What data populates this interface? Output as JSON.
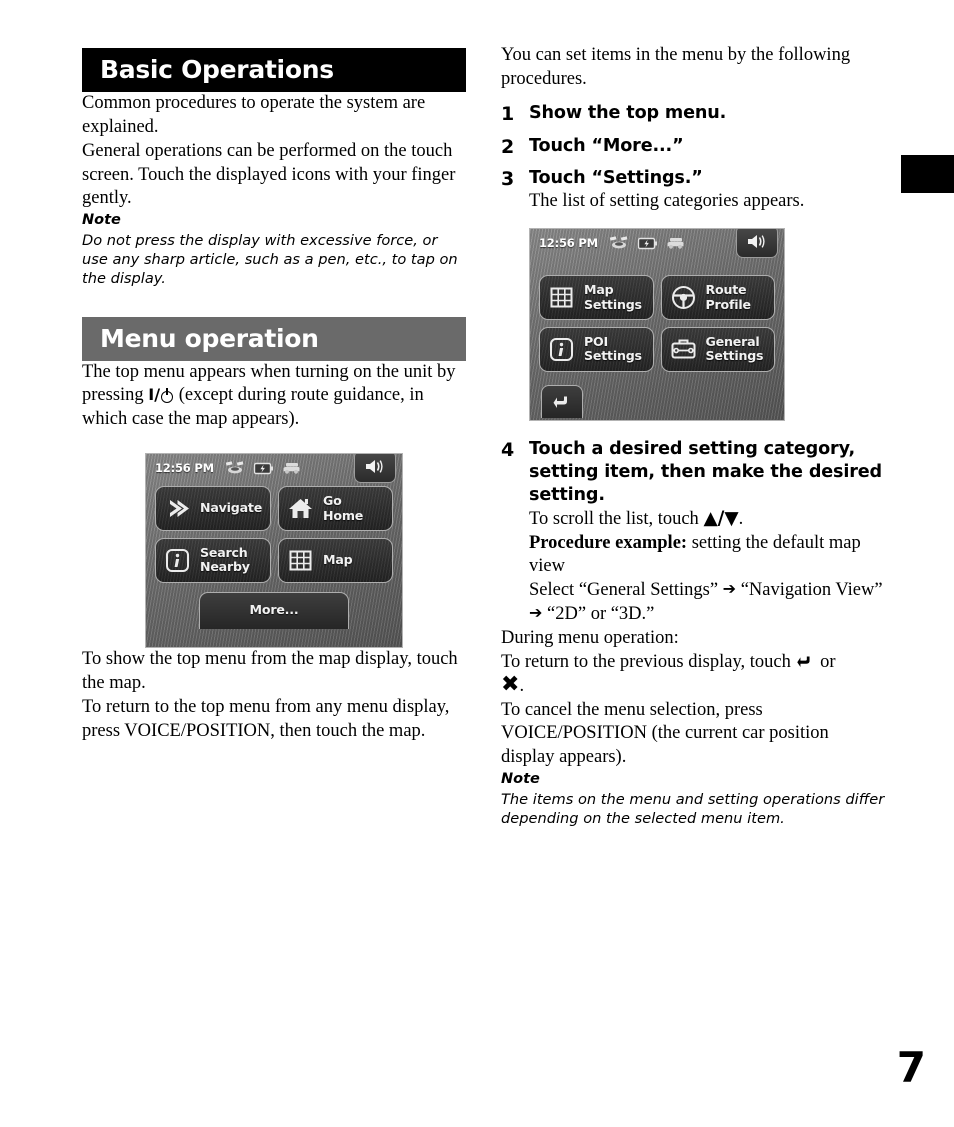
{
  "page": {
    "number": "7"
  },
  "left_column": {
    "section1": {
      "heading": "Basic Operations",
      "paragraph1": "Common procedures to operate the system are explained.",
      "paragraph2_a": "General operations can be performed on the touch screen. Touch the displayed icons with your finger gently.",
      "note_label": "Note",
      "note_text": "Do not press the display with excessive force, or use any sharp article, such as a pen, etc., to tap on the display."
    },
    "section2": {
      "heading": "Menu operation",
      "paragraph_pre": "The top menu appears when turning on the unit by pressing ",
      "power_symbol": "I/",
      "paragraph_post": " (except during route guidance, in which case the map appears).",
      "after_image_1": "To show the top menu from the map display, touch the map.",
      "after_image_2": "To return to the top menu from any menu display, press VOICE/POSITION, then touch the map."
    },
    "top_menu_screen": {
      "time": "12:56 PM",
      "icons": [
        "satellite-icon",
        "battery-icon",
        "car-icon",
        "speaker-icon"
      ],
      "buttons": [
        {
          "label": "Navigate",
          "icon": "chevron-right-icon"
        },
        {
          "label": "Go Home",
          "icon": "home-icon"
        },
        {
          "label": "Search Nearby",
          "icon": "info-icon"
        },
        {
          "label": "Map",
          "icon": "grid-icon"
        }
      ],
      "more_label": "More..."
    }
  },
  "right_column": {
    "intro": "You can set items in the menu by the following procedures.",
    "steps": [
      {
        "num": "1",
        "title": "Show the top menu.",
        "sub": ""
      },
      {
        "num": "2",
        "title": "Touch “More...”",
        "sub": ""
      },
      {
        "num": "3",
        "title": "Touch “Settings.”",
        "sub": "The list of setting categories appears."
      },
      {
        "num": "4",
        "title": "Touch a desired setting category, setting item, then make the desired setting.",
        "sub": ""
      }
    ],
    "step4_details": {
      "scroll_line_pre": "To scroll the list, touch ",
      "scroll_line_glyph": "▲/▼",
      "scroll_line_post": ".",
      "example_label": "Procedure example:",
      "example_text": " setting the default map view",
      "select_line_a": "Select “General Settings”",
      "select_arrow": "➔",
      "select_line_b": "“Navigation View”",
      "select_line_c": "“2D” or “3D.”"
    },
    "during_menu": {
      "heading": "During menu operation:",
      "line1_pre": "To return to the previous display, touch ",
      "line1_mid": " or",
      "line1_x": "✖",
      "line1_end": ".",
      "line2": "To cancel the menu selection, press VOICE/POSITION (the current car position display appears)."
    },
    "note_label": "Note",
    "note_text": "The items on the menu and setting operations differ depending on the selected menu item.",
    "settings_screen": {
      "time": "12:56 PM",
      "icons": [
        "satellite-icon",
        "battery-icon",
        "car-icon",
        "speaker-icon"
      ],
      "buttons": [
        {
          "label": "Map Settings",
          "icon": "grid-icon"
        },
        {
          "label": "Route Profile",
          "icon": "steering-wheel-icon"
        },
        {
          "label": "POI Settings",
          "icon": "info-icon"
        },
        {
          "label": "General Settings",
          "icon": "toolbox-icon"
        }
      ],
      "back_icon": "return-arrow-icon"
    }
  },
  "colors": {
    "heading_black": "#000000",
    "heading_gray": "#6a6a6a",
    "text": "#000000",
    "device_bg": "#6e6e6e"
  }
}
